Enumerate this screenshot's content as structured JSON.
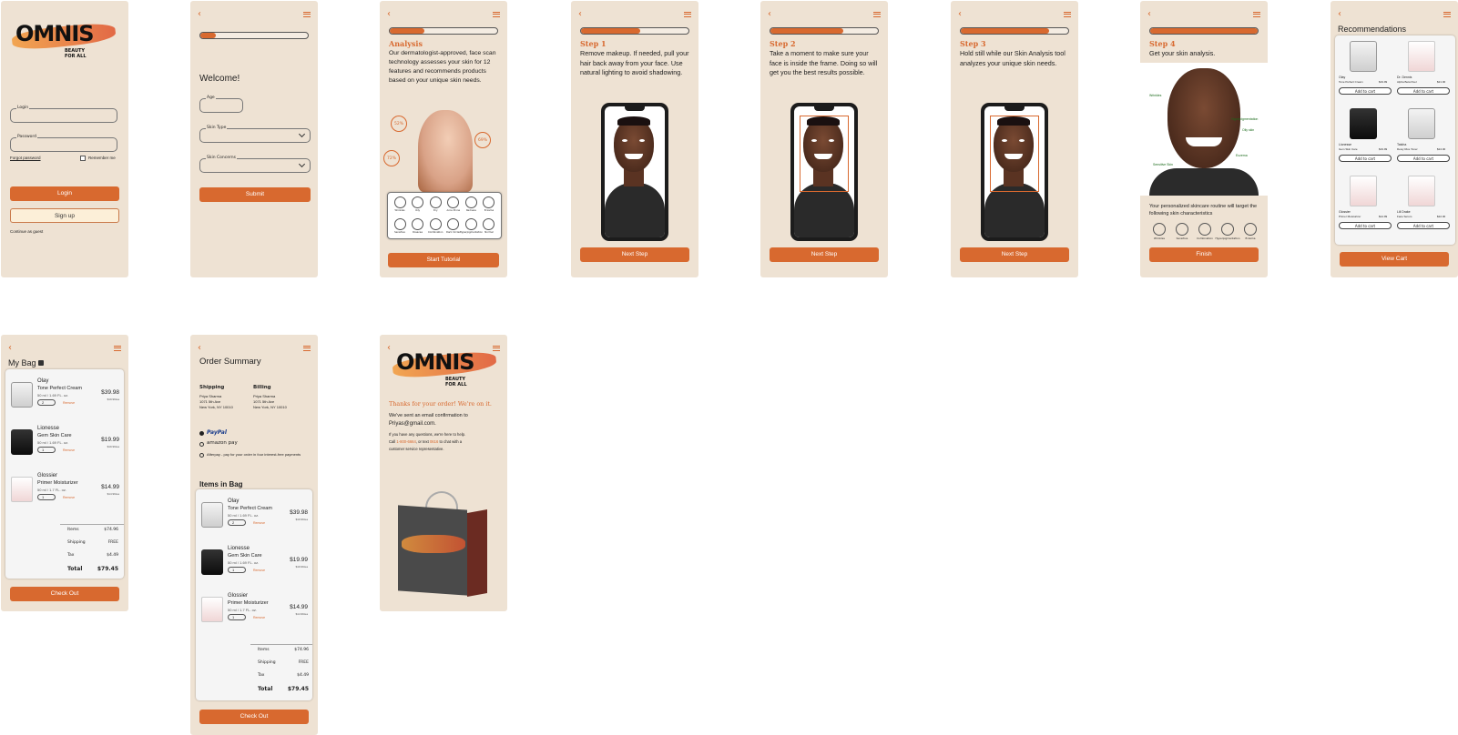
{
  "brand": {
    "name": "OMNIS",
    "tagline": "BEAUTY FOR ALL"
  },
  "login": {
    "login_label": "Login",
    "password_label": "Password",
    "forgot": "Forgot password",
    "remember": "Remember me",
    "login_btn": "Login",
    "signup_btn": "Sign up",
    "guest": "Continue as guest"
  },
  "welcome": {
    "title": "Welcome!",
    "age_label": "Age",
    "skin_type_label": "Skin Type",
    "skin_concerns_label": "Skin Concerns",
    "submit": "Submit",
    "progress": 0.12
  },
  "analysis": {
    "title": "Analysis",
    "text": "Our dermatologist-approved, face scan technology assesses your skin for 12 features and recommends products based on your unique skin needs.",
    "stat1": "52%",
    "stat2": "69%",
    "stat3": "72%",
    "features_row1": [
      "Wrinkles",
      "Oily",
      "Dry",
      "Acne Prone",
      "Redness",
      "Eczema"
    ],
    "features_row2": [
      "Sensitive",
      "Rosacea",
      "Combination",
      "Dark Circles",
      "Hyperpigmentation",
      "Normal"
    ],
    "start": "Start Tutorial",
    "progress": 0.32
  },
  "steps": [
    {
      "title": "Step 1",
      "text": "Remove makeup. If needed, pull your hair back away from your face. Use natural lighting to avoid shadowing.",
      "button": "Next Step",
      "progress": 0.55
    },
    {
      "title": "Step 2",
      "text": "Take a moment to make sure your face is inside the frame. Doing so will get you the best results possible.",
      "button": "Next Step",
      "progress": 0.68
    },
    {
      "title": "Step 3",
      "text": "Hold still while our Skin Analysis tool analyzes your unique skin needs.",
      "button": "Next Step",
      "progress": 0.82
    }
  ],
  "step4": {
    "title": "Step 4",
    "text": "Get your skin analysis.",
    "tags": [
      "Wrinkles",
      "Hyperpigmentation",
      "Oily skin",
      "Eczema",
      "Sensitive Skin"
    ],
    "routine": "Your personalized skincare routine will target the following skin characteristics",
    "icons": [
      "Wrinkles",
      "Sensitive",
      "Combination",
      "Hyperpigmentation",
      "Eczema"
    ],
    "finish": "Finish",
    "progress": 1.0
  },
  "recommendations": {
    "title": "Recommendations",
    "products": [
      {
        "brand": "Olay",
        "name": "Tone Perfect Cream",
        "price": "$19.99"
      },
      {
        "brand": "Dr. Dennis",
        "name": "Alpha Beta Peel",
        "price": "$21.00"
      },
      {
        "brand": "Lionesse",
        "name": "Gem Skin Care",
        "price": "$19.99"
      },
      {
        "brand": "Tatcha",
        "name": "Dewy Rice Toner",
        "price": "$24.00"
      },
      {
        "brand": "Glossier",
        "name": "Primer Moisturizer",
        "price": "$14.99"
      },
      {
        "brand": "Lili Drake",
        "name": "Face Serum",
        "price": "$22.00"
      }
    ],
    "add_btn": "Add to cart",
    "view_cart": "View Cart"
  },
  "bag": {
    "title": "My Bag",
    "items": [
      {
        "brand": "Olay",
        "name": "Tone Perfect Cream",
        "size": "50 ml / 1.69 FL. oz.",
        "qty": "2",
        "price": "$39.98",
        "unit": "$19.99/ea",
        "remove": "Remove"
      },
      {
        "brand": "Lionesse",
        "name": "Gem Skin Care",
        "size": "50 ml / 1.69 FL. oz.",
        "qty": "1",
        "price": "$19.99",
        "unit": "$19.99/ea",
        "remove": "Remove"
      },
      {
        "brand": "Glossier",
        "name": "Primer Moisturizer",
        "size": "50 ml / 1.7 FL. oz.",
        "qty": "1",
        "price": "$14.99",
        "unit": "$14.99/ea",
        "remove": "Remove"
      }
    ],
    "items_label": "Items",
    "items_value": "$74.96",
    "shipping_label": "Shipping",
    "shipping_value": "FREE",
    "tax_label": "Tax",
    "tax_value": "$4.49",
    "total_label": "Total",
    "total_value": "$79.45",
    "checkout": "Check Out"
  },
  "order": {
    "title": "Order Summary",
    "shipping_head": "Shipping",
    "billing_head": "Billing",
    "address_name": "Priya Sharma",
    "address_l1": "1071 5th Ave",
    "address_l2": "New York, NY 10010",
    "paypal": "PayPal",
    "amazon": "amazon pay",
    "afterpay": "Afterpay - pay for your order in four interest-free payments",
    "items_head": "Items in Bag",
    "checkout": "Check Out"
  },
  "thanks": {
    "headline": "Thanks for your order! We're on it.",
    "email_line": "We've sent an email confirmation to",
    "email": "Priyas@gmail.com.",
    "help_1": "If you have any questions, we're here to help.",
    "help_2a": "Call",
    "phone": "1-800-6664",
    "help_2b": ", or text",
    "text_num": "0616",
    "help_2c": "to chat with a",
    "help_3": "customer service representative."
  }
}
